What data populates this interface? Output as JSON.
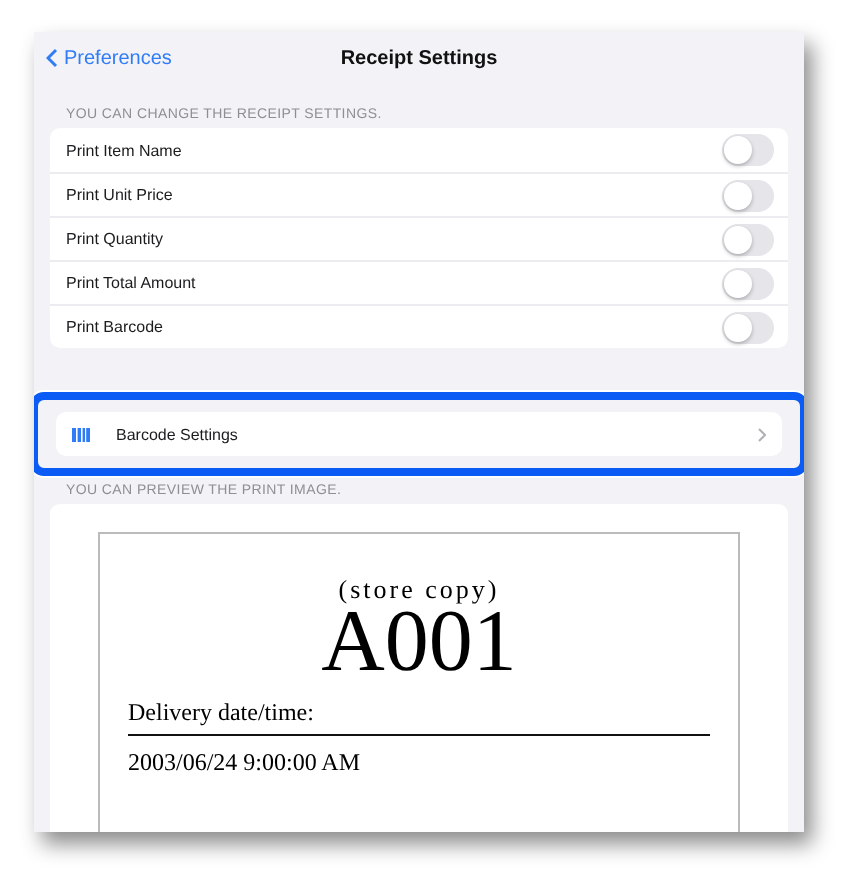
{
  "nav": {
    "back_label": "Preferences",
    "title": "Receipt Settings"
  },
  "settings_section": {
    "header": "YOU CAN CHANGE THE RECEIPT SETTINGS.",
    "toggles": [
      {
        "label": "Print Item Name",
        "on": false
      },
      {
        "label": "Print Unit Price",
        "on": false
      },
      {
        "label": "Print Quantity",
        "on": false
      },
      {
        "label": "Print Total Amount",
        "on": false
      },
      {
        "label": "Print Barcode",
        "on": false
      }
    ]
  },
  "barcode_row": {
    "label": "Barcode Settings",
    "highlighted": true
  },
  "preview_section": {
    "header": "YOU CAN PREVIEW THE PRINT IMAGE.",
    "receipt": {
      "copy_label": "(store copy)",
      "number": "A001",
      "field_label": "Delivery date/time:",
      "field_value": "2003/06/24 9:00:00 AM"
    }
  }
}
